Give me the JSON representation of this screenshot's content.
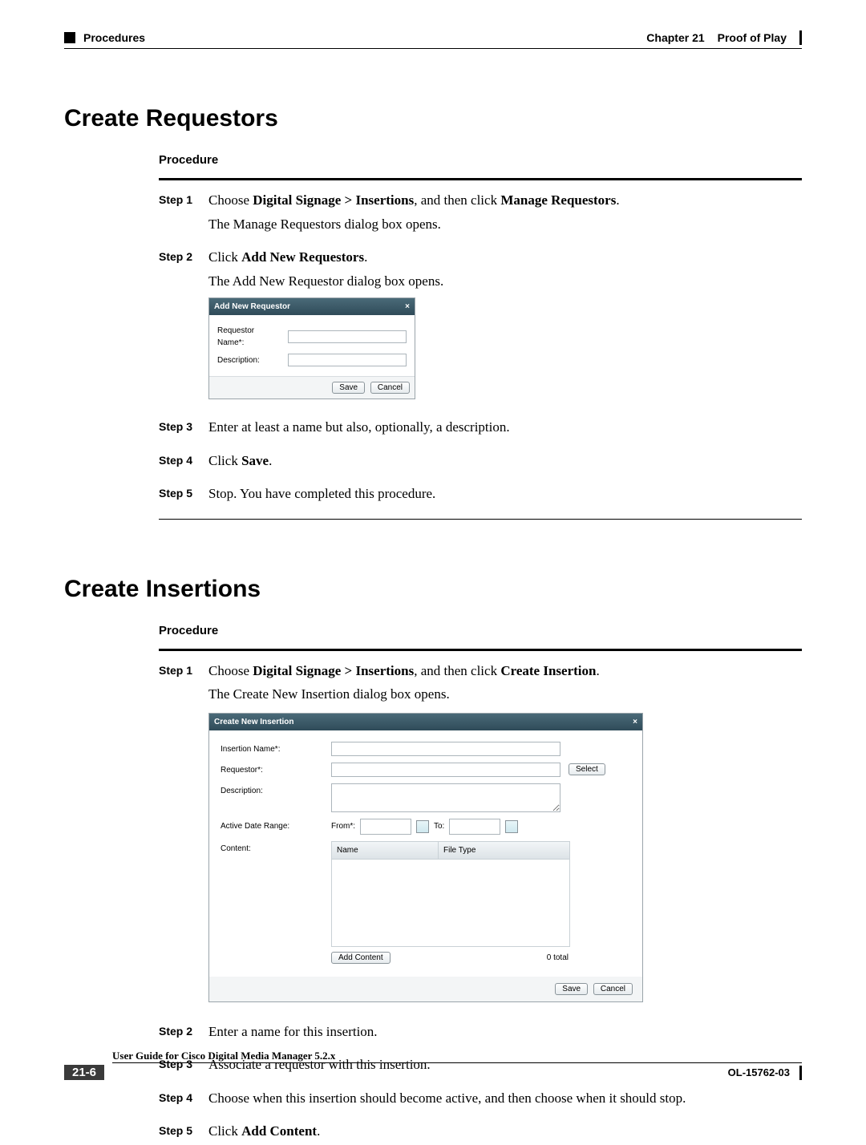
{
  "header": {
    "procedures": "Procedures",
    "chapter": "Chapter 21",
    "title": "Proof of Play"
  },
  "sections": {
    "requestors": {
      "heading": "Create Requestors",
      "procedure_label": "Procedure",
      "step1_label": "Step 1",
      "step1_prefix": "Choose ",
      "step1_bold": "Digital Signage > Insertions",
      "step1_mid": ", and then click ",
      "step1_bold2": "Manage Requestors",
      "step1_suffix": ".",
      "step1_line2": "The Manage Requestors dialog box opens.",
      "step2_label": "Step 2",
      "step2_prefix": "Click ",
      "step2_bold": "Add New Requestors",
      "step2_suffix": ".",
      "step2_line2": "The Add New Requestor dialog box opens.",
      "step3_label": "Step 3",
      "step3_text": "Enter at least a name but also, optionally, a description.",
      "step4_label": "Step 4",
      "step4_prefix": "Click ",
      "step4_bold": "Save",
      "step4_suffix": ".",
      "step5_label": "Step 5",
      "step5_text": "Stop. You have completed this procedure."
    },
    "insertions": {
      "heading": "Create Insertions",
      "procedure_label": "Procedure",
      "step1_label": "Step 1",
      "step1_prefix": "Choose ",
      "step1_bold": "Digital Signage > Insertions",
      "step1_mid": ", and then click ",
      "step1_bold2": "Create Insertion",
      "step1_suffix": ".",
      "step1_line2": "The Create New Insertion dialog box opens.",
      "step2_label": "Step 2",
      "step2_text": "Enter a name for this insertion.",
      "step3_label": "Step 3",
      "step3_text": "Associate a requestor with this insertion.",
      "step4_label": "Step 4",
      "step4_text": "Choose when this insertion should become active, and then choose when it should stop.",
      "step5_label": "Step 5",
      "step5_prefix": "Click ",
      "step5_bold": "Add Content",
      "step5_suffix": "."
    }
  },
  "dialogs": {
    "requestor": {
      "title": "Add New Requestor",
      "close": "×",
      "name_label": "Requestor Name*:",
      "desc_label": "Description:",
      "save": "Save",
      "cancel": "Cancel"
    },
    "insertion": {
      "title": "Create New Insertion",
      "close": "×",
      "insertion_name": "Insertion Name*:",
      "requestor": "Requestor*:",
      "select_btn": "Select",
      "description": "Description:",
      "active_range": "Active Date Range:",
      "from": "From*:",
      "to": "To:",
      "content": "Content:",
      "col_name": "Name",
      "col_type": "File Type",
      "add_content": "Add Content",
      "total": "0 total",
      "save": "Save",
      "cancel": "Cancel"
    }
  },
  "footer": {
    "guide": "User Guide for Cisco Digital Media Manager 5.2.x",
    "page": "21-6",
    "docnum": "OL-15762-03"
  }
}
